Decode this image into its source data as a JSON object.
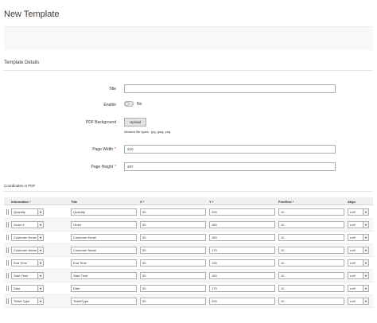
{
  "page": {
    "title": "New Template"
  },
  "section": {
    "title": "Template Details"
  },
  "form": {
    "title_label": "Title",
    "title_value": "",
    "enable_label": "Enable",
    "enable_state": "No",
    "pdf_background_label": "PDF Background",
    "upload_label": "Upload",
    "allowed_types": "Allowed file types : jpg, jpeg, png.",
    "page_width_label": "Page Width",
    "page_width_value": "210",
    "page_height_label": "Page Height",
    "page_height_value": "297",
    "required_marker": "*"
  },
  "coordinates": {
    "title": "Coordinates in PDF",
    "headers": {
      "information": "Information *",
      "title": "Title",
      "x": "X *",
      "y": "Y *",
      "font_size": "FontSize *",
      "align": "Align"
    },
    "select_arrow": "▾",
    "rows": [
      {
        "information": "Quantity",
        "title": "Quantity",
        "x": "50",
        "y": "200",
        "font_size": "10",
        "align": "Left"
      },
      {
        "information": "Order #",
        "title": "Order",
        "x": "50",
        "y": "180",
        "font_size": "10",
        "align": "Left"
      },
      {
        "information": "Customer Email",
        "title": "Customer Email",
        "x": "50",
        "y": "160",
        "font_size": "10",
        "align": "Left"
      },
      {
        "information": "Customer Name",
        "title": "Customer Name",
        "x": "50",
        "y": "170",
        "font_size": "10",
        "align": "Left"
      },
      {
        "information": "End Time",
        "title": "End Time",
        "x": "50",
        "y": "130",
        "font_size": "10",
        "align": "Left"
      },
      {
        "information": "Start Time",
        "title": "Start Time",
        "x": "50",
        "y": "150",
        "font_size": "10",
        "align": "Left"
      },
      {
        "information": "Date",
        "title": "Date",
        "x": "50",
        "y": "170",
        "font_size": "10",
        "align": "Left"
      },
      {
        "information": "Ticket Type",
        "title": "TicketType",
        "x": "50",
        "y": "200",
        "font_size": "10",
        "align": "Left"
      }
    ]
  }
}
